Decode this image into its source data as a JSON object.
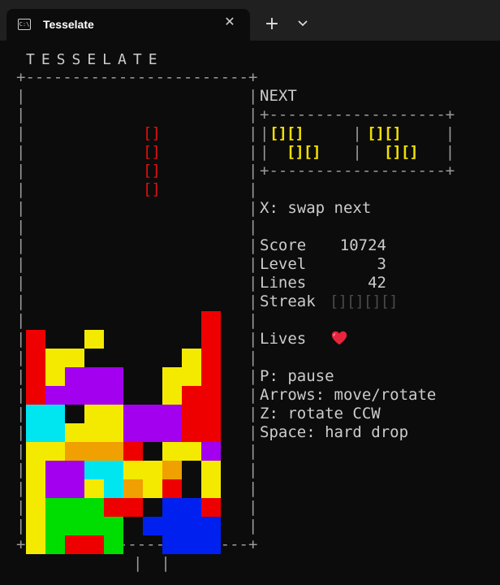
{
  "window": {
    "tab_title": "Tesselate",
    "tab_icon": "terminal-icon",
    "close_icon": "close-icon",
    "new_tab_icon": "plus-icon",
    "dropdown_icon": "chevron-down-icon"
  },
  "game": {
    "title": "TESSELATE",
    "falling_piece": "[]\n[]\n[]\n[]",
    "below_marks": "|  |"
  },
  "next": {
    "label": "NEXT",
    "piece1": "[][]\n  [][]",
    "piece2": "[][]\n  [][]"
  },
  "stats": {
    "swap_hint": "X: swap next",
    "score_label": "Score",
    "score": "10724",
    "level_label": "Level",
    "level": "3",
    "lines_label": "Lines",
    "lines": "42",
    "streak_label": "Streak",
    "streak": "[][][][]",
    "lives_label": "Lives"
  },
  "controls": {
    "pause": "P: pause",
    "arrows": "Arrows: move/rotate",
    "rotate_ccw": "Z: rotate CCW",
    "space": "Space: hard drop"
  },
  "colors": {
    "R": "#ee0000",
    "Y": "#f4ea00",
    "P": "#a200ee",
    "C": "#00e6f0",
    "O": "#f0a000",
    "G": "#00dd00",
    "B": "#0020f0",
    "falling": "#e01010",
    "next": "#f0e000"
  },
  "board": {
    "rows": [
      "         R",
      "R  Y     R",
      "RYY     YR",
      "RYPPP  YYR",
      "RPPPP  YRR",
      "CC YYPPPRR",
      "CCYYYPPPRR",
      "YYOOOR YYP",
      "YPPCCYYO Y",
      "YPPYCOYR Y",
      "YGGGRR BBR",
      "YGGGG BBBB",
      "YGRRG  BBB"
    ]
  }
}
